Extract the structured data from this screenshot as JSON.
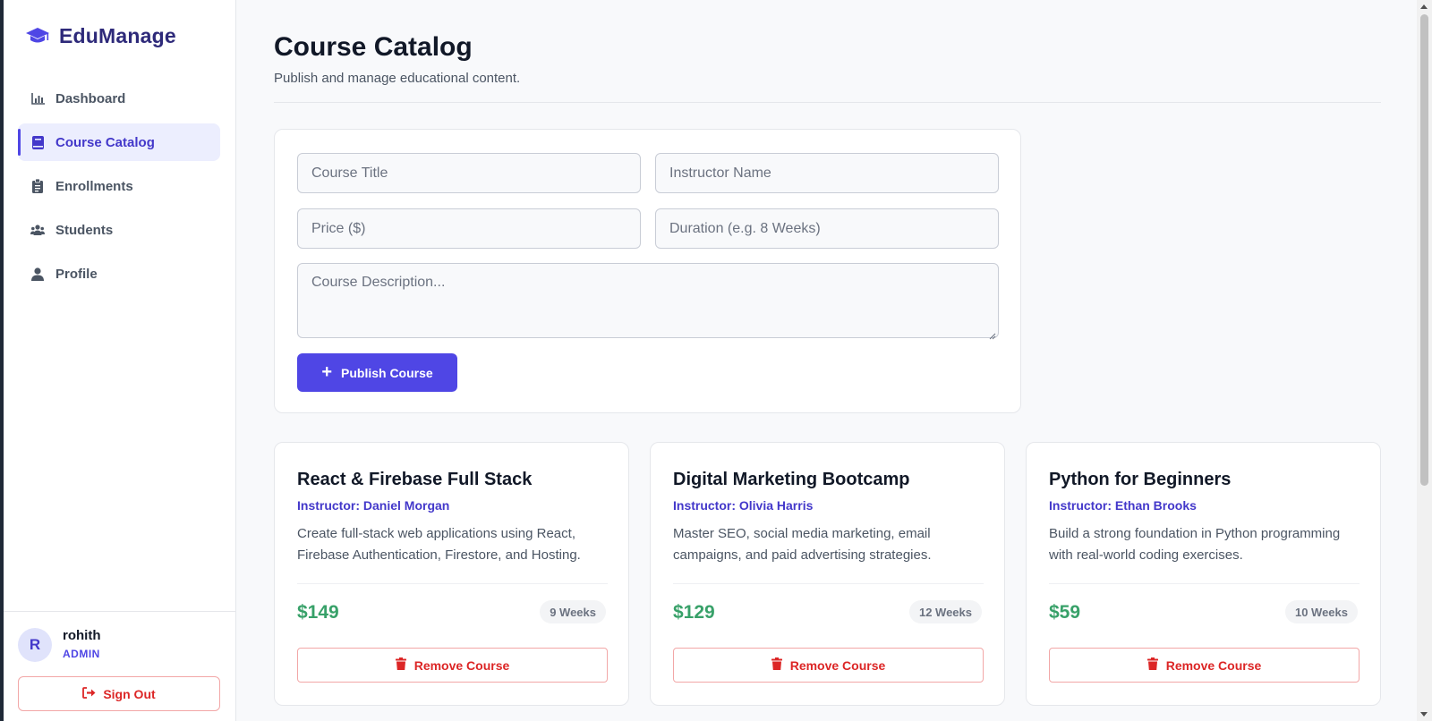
{
  "brand": {
    "name": "EduManage",
    "icon": "graduation-cap-icon"
  },
  "sidebar": {
    "items": [
      {
        "label": "Dashboard",
        "icon": "bar-chart-icon",
        "active": false
      },
      {
        "label": "Course Catalog",
        "icon": "book-icon",
        "active": true
      },
      {
        "label": "Enrollments",
        "icon": "clipboard-icon",
        "active": false
      },
      {
        "label": "Students",
        "icon": "users-icon",
        "active": false
      },
      {
        "label": "Profile",
        "icon": "user-icon",
        "active": false
      }
    ]
  },
  "user": {
    "initial": "R",
    "name": "rohith",
    "role": "ADMIN",
    "signout_label": "Sign Out"
  },
  "page": {
    "title": "Course Catalog",
    "subtitle": "Publish and manage educational content."
  },
  "form": {
    "title_placeholder": "Course Title",
    "instructor_placeholder": "Instructor Name",
    "price_placeholder": "Price ($)",
    "duration_placeholder": "Duration (e.g. 8 Weeks)",
    "description_placeholder": "Course Description...",
    "publish_label": "Publish Course"
  },
  "courses": [
    {
      "title": "React & Firebase Full Stack",
      "instructor": "Instructor: Daniel Morgan",
      "description": "Create full-stack web applications using React, Firebase Authentication, Firestore, and Hosting.",
      "price": "$149",
      "duration": "9 Weeks",
      "remove_label": "Remove Course"
    },
    {
      "title": "Digital Marketing Bootcamp",
      "instructor": "Instructor: Olivia Harris",
      "description": "Master SEO, social media marketing, email campaigns, and paid advertising strategies.",
      "price": "$129",
      "duration": "12 Weeks",
      "remove_label": "Remove Course"
    },
    {
      "title": "Python for Beginners",
      "instructor": "Instructor: Ethan Brooks",
      "description": "Build a strong foundation in Python programming with real-world coding exercises.",
      "price": "$59",
      "duration": "10 Weeks",
      "remove_label": "Remove Course"
    }
  ],
  "colors": {
    "accent": "#4f46e5",
    "price": "#38a169",
    "danger": "#dc2626",
    "brand_text": "#2e2a7a"
  }
}
